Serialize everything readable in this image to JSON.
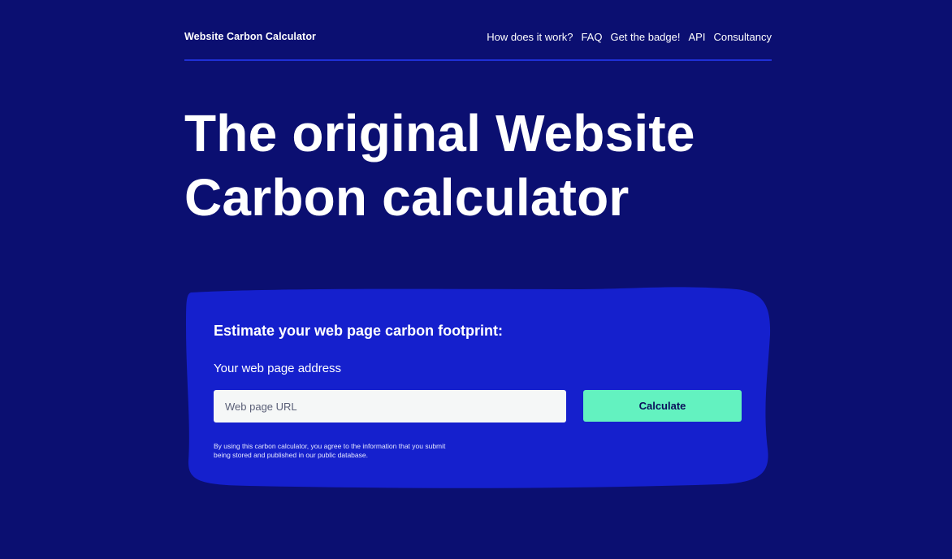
{
  "header": {
    "brand": "Website Carbon Calculator",
    "nav": [
      {
        "label": "How does it work?"
      },
      {
        "label": "FAQ"
      },
      {
        "label": "Get the badge!"
      },
      {
        "label": "API"
      },
      {
        "label": "Consultancy"
      }
    ]
  },
  "hero": {
    "line1": "The original Website",
    "line2": "Carbon calculator"
  },
  "calculator": {
    "title": "Estimate your web page carbon footprint:",
    "field_label": "Your web page address",
    "input_placeholder": "Web page URL",
    "input_value": "",
    "button_label": "Calculate",
    "disclaimer": "By using this carbon calculator, you agree to the information that you submit being stored and published in our public database."
  },
  "colors": {
    "background": "#0b0f71",
    "card": "#1520cd",
    "rule": "#1f2fd6",
    "button": "#63f2c0",
    "input": "#f5f7f7"
  }
}
